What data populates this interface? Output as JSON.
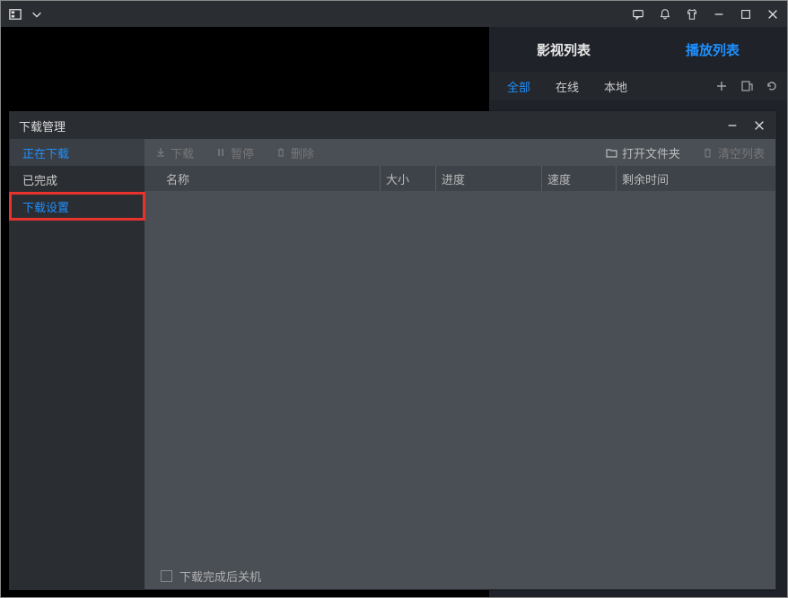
{
  "sidepanel": {
    "tabs": {
      "video_list": "影视列表",
      "play_list": "播放列表"
    },
    "filters": {
      "all": "全部",
      "online": "在线",
      "local": "本地"
    }
  },
  "dlm": {
    "title": "下载管理",
    "sidebar": {
      "downloading": "正在下载",
      "completed": "已完成",
      "settings": "下载设置"
    },
    "toolbar": {
      "download": "下载",
      "pause": "暂停",
      "delete": "删除",
      "open_folder": "打开文件夹",
      "clear_list": "清空列表"
    },
    "headers": {
      "name": "名称",
      "size": "大小",
      "progress": "进度",
      "speed": "速度",
      "remain": "剩余时间"
    },
    "footer": {
      "shutdown": "下载完成后关机"
    }
  }
}
